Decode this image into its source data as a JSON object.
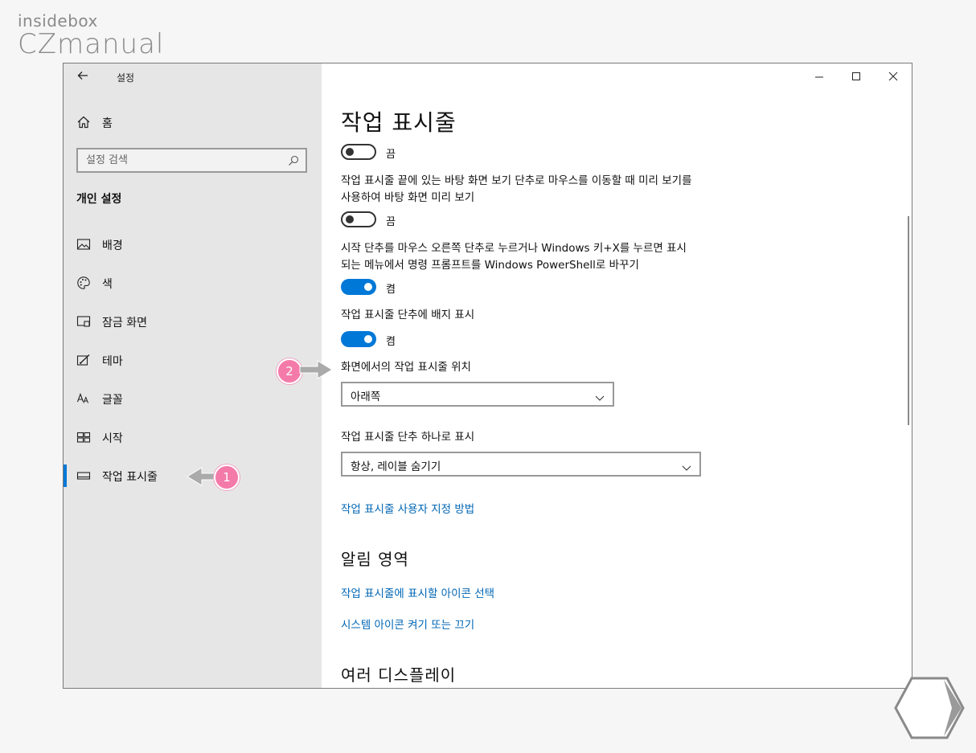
{
  "brand": {
    "small": "insidebox",
    "big": "CZmanual"
  },
  "window": {
    "title": "설정"
  },
  "sidebar": {
    "home": "홈",
    "search_placeholder": "설정 검색",
    "section": "개인 설정",
    "items": [
      {
        "label": "배경",
        "icon": "picture-icon"
      },
      {
        "label": "색",
        "icon": "palette-icon"
      },
      {
        "label": "잠금 화면",
        "icon": "lock-screen-icon"
      },
      {
        "label": "테마",
        "icon": "theme-icon"
      },
      {
        "label": "글꼴",
        "icon": "font-icon"
      },
      {
        "label": "시작",
        "icon": "start-icon"
      },
      {
        "label": "작업 표시줄",
        "icon": "taskbar-icon",
        "active": true
      }
    ]
  },
  "main": {
    "title": "작업 표시줄",
    "toggle1": {
      "state": "끔"
    },
    "setting2": {
      "text": "작업 표시줄 끝에 있는 바탕 화면 보기 단추로 마우스를 이동할 때 미리 보기를 사용하여 바탕 화면 미리 보기",
      "state": "끔"
    },
    "setting3": {
      "text": "시작 단추를 마우스 오른쪽 단추로 누르거나 Windows 키+X를 누르면 표시되는 메뉴에서 명령 프롬프트를 Windows PowerShell로 바꾸기",
      "state": "켬"
    },
    "setting4": {
      "text": "작업 표시줄 단추에 배지 표시",
      "state": "켬"
    },
    "position": {
      "label": "화면에서의 작업 표시줄 위치",
      "value": "아래쪽"
    },
    "combine": {
      "label": "작업 표시줄 단추 하나로 표시",
      "value": "항상, 레이블 숨기기"
    },
    "link_customize": "작업 표시줄 사용자 지정 방법",
    "notification": {
      "heading": "알림 영역",
      "link1": "작업 표시줄에 표시할 아이콘 선택",
      "link2": "시스템 아이콘 켜기 또는 끄기"
    },
    "multi_display": {
      "heading": "여러 디스플레이"
    }
  },
  "annotations": {
    "badge1": "1",
    "badge2": "2"
  },
  "colors": {
    "accent": "#0078d7",
    "link": "#0066b4",
    "badge": "#f37aa9"
  }
}
